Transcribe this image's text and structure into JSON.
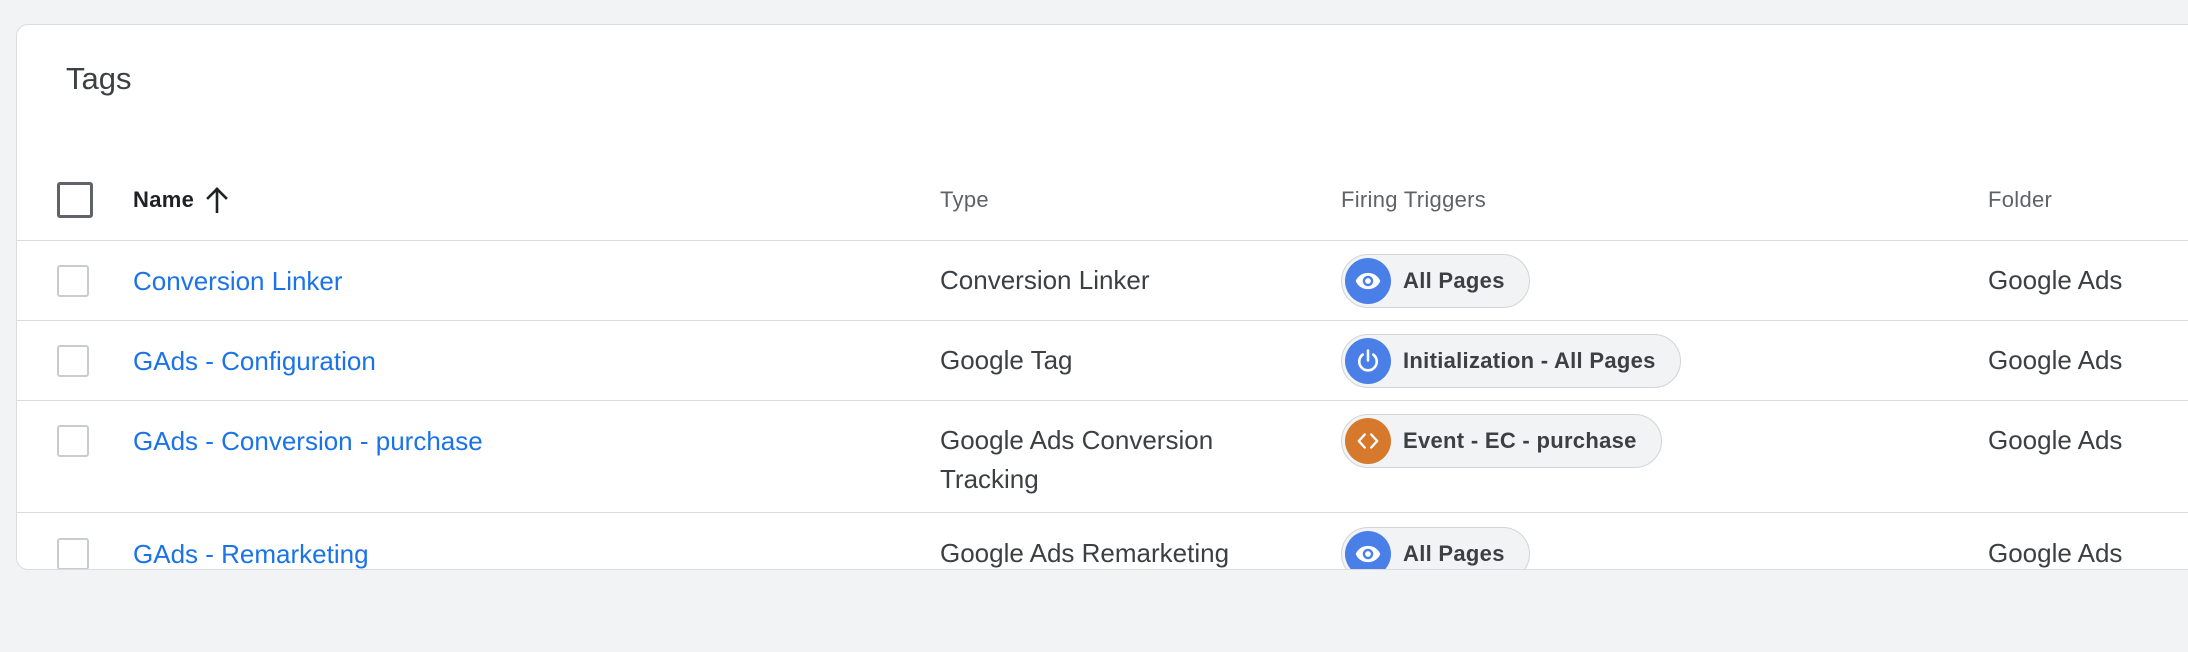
{
  "title": "Tags",
  "columns": {
    "name": "Name",
    "type": "Type",
    "firing_triggers": "Firing Triggers",
    "folder": "Folder"
  },
  "sort": {
    "column": "Name",
    "direction": "ascending",
    "icon": "arrow-up-icon"
  },
  "colors": {
    "link": "#1a73e8",
    "trigger_blue": "#4a7fe8",
    "trigger_orange": "#d6792c"
  },
  "rows": [
    {
      "name": "Conversion Linker",
      "type": "Conversion Linker",
      "trigger": {
        "label": "All Pages",
        "icon": "eye-icon",
        "color": "#4a7fe8"
      },
      "folder": "Google Ads"
    },
    {
      "name": "GAds - Configuration",
      "type": "Google Tag",
      "trigger": {
        "label": "Initialization - All Pages",
        "icon": "power-icon",
        "color": "#4a7fe8"
      },
      "folder": "Google Ads"
    },
    {
      "name": "GAds - Conversion - purchase",
      "type_line1": "Google Ads Conversion",
      "type_line2": "Tracking",
      "trigger": {
        "label": "Event - EC - purchase",
        "icon": "code-icon",
        "color": "#d6792c"
      },
      "folder": "Google Ads"
    },
    {
      "name": "GAds - Remarketing",
      "type": "Google Ads Remarketing",
      "trigger": {
        "label": "All Pages",
        "icon": "eye-icon",
        "color": "#4a7fe8"
      },
      "folder": "Google Ads"
    }
  ]
}
